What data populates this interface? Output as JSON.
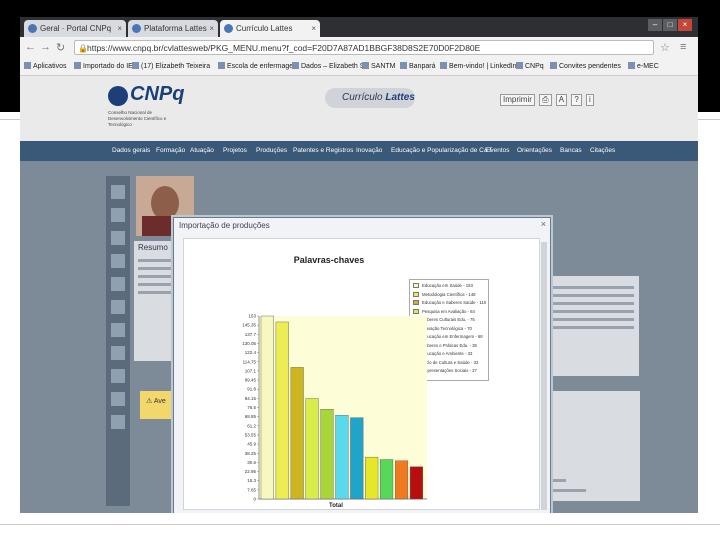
{
  "browser": {
    "tabs": [
      {
        "label": "Geral · Portal CNPq"
      },
      {
        "label": "Plataforma Lattes"
      },
      {
        "label": "Currículo Lattes"
      }
    ],
    "url": "https://www.cnpq.br/cvlattesweb/PKG_MENU.menu?f_cod=F20D7A87AD1BBGF38D8S2E70D0F2D80E",
    "bookmarks": [
      "Aplicativos",
      "Importado do IE",
      "(17) Elizabeth Teixeira",
      "Escola de enfermagem",
      "Dados – Elizabeth S.",
      "SANTM",
      "Banpará",
      "Bem-vindo! | LinkedIn",
      "CNPq",
      "Convites pendentes",
      "e-MEC"
    ]
  },
  "header": {
    "logo": "CNPq",
    "logo_sub": "Conselho Nacional de Desenvolvimento Científico e Tecnológico",
    "curriculo_label": "Currículo",
    "lattes_label": "Lattes",
    "tools": [
      "Imprimir"
    ]
  },
  "nav_menu": [
    "Dados gerais",
    "Formação",
    "Atuação",
    "Projetos",
    "Produções",
    "Patentes e Registros",
    "Inovação",
    "Educação e Popularização de C&T",
    "Eventos",
    "Orientações",
    "Bancas",
    "Citações"
  ],
  "content": {
    "resumo_title": "Resumo",
    "alert_title": "Ave"
  },
  "modal": {
    "title": "Importação de produções",
    "close": "×"
  },
  "chart_data": {
    "type": "bar",
    "title": "Palavras-chaves",
    "xlabel": "Total",
    "ylabel": "",
    "ylim": [
      0,
      153
    ],
    "yticks": [
      0,
      7.65,
      15.3,
      22.95,
      30.6,
      38.25,
      45.9,
      53.55,
      61.2,
      68.85,
      76.5,
      84.15,
      91.8,
      99.45,
      107.1,
      114.75,
      122.4,
      130.05,
      137.7,
      145.35,
      153
    ],
    "ytick_labels": [
      "0",
      "7.65",
      "15.3",
      "22.95",
      "30.6",
      "38.25",
      "45.9",
      "53.55",
      "61.2",
      "68.85",
      "76.5",
      "84.15",
      "91.8",
      "99.45",
      "107.1",
      "114.75",
      "122.4",
      "130.05",
      "137.7",
      "145.35",
      "153"
    ],
    "plot_bg_color": "#fdfdd8",
    "series": [
      {
        "name": "Educação em Saúde",
        "value": 153,
        "color": "#f7f7c0"
      },
      {
        "name": "Metodologia Científica",
        "value": 148,
        "color": "#ecec55"
      },
      {
        "name": "Educação e Saberes Saúde",
        "value": 110,
        "color": "#cdb51f"
      },
      {
        "name": "Pesquisa em Avaliação",
        "value": 84,
        "color": "#d9ec4a"
      },
      {
        "name": "Saberes Culturais Edu.",
        "value": 75,
        "color": "#a8d63a"
      },
      {
        "name": "Inovação Tecnológica",
        "value": 70,
        "color": "#5ad8ec"
      },
      {
        "name": "Educação em Enfermagem",
        "value": 68,
        "color": "#20a4c8"
      },
      {
        "name": "Saberes e Práticas Edu.",
        "value": 35,
        "color": "#e6e62a"
      },
      {
        "name": "Educação e Ambiente",
        "value": 33,
        "color": "#58d858"
      },
      {
        "name": "Ciclo de Cultura e Saúde",
        "value": 32,
        "color": "#f07a20"
      },
      {
        "name": "Representações Sociais",
        "value": 27,
        "color": "#b80e0e"
      }
    ]
  }
}
